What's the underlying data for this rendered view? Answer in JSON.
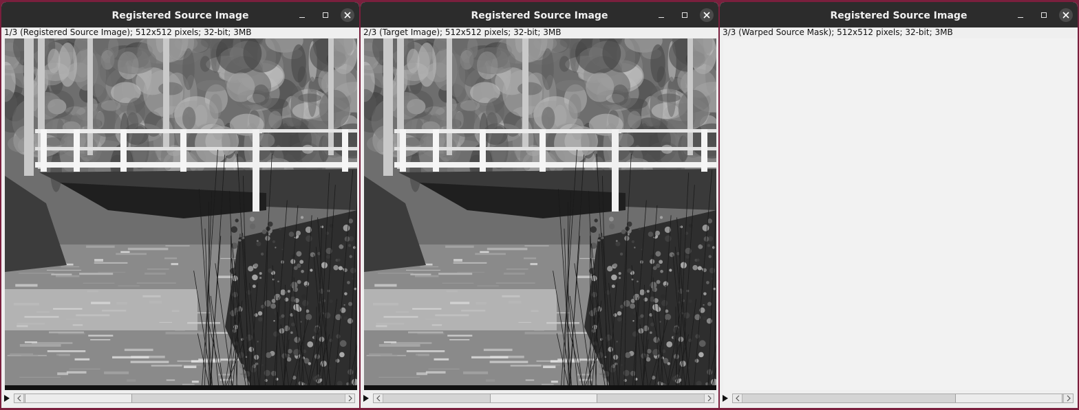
{
  "windows": [
    {
      "title": "Registered Source Image",
      "info": "1/3 (Registered Source Image); 512x512 pixels; 32-bit; 3MB",
      "content": "image",
      "image_shift": 0,
      "slider_position": 0.0
    },
    {
      "title": "Registered Source Image",
      "info": "2/3 (Target Image); 512x512 pixels; 32-bit; 3MB",
      "content": "image",
      "image_shift": 0,
      "slider_position": 0.5
    },
    {
      "title": "Registered Source Image",
      "info": "3/3 (Warped Source Mask); 512x512 pixels; 32-bit; 3MB",
      "content": "blank",
      "image_shift": 0,
      "slider_position": 1.0
    }
  ],
  "icons": {
    "minimize": "minimize-icon",
    "maximize": "maximize-icon",
    "close": "close-icon",
    "play": "play-icon",
    "scroll_left": "chevron-left-icon",
    "scroll_right": "chevron-right-icon"
  },
  "colors": {
    "desktop": "#7a1f3d",
    "titlebar": "#2c2c2c",
    "window_bg": "#efefef"
  }
}
